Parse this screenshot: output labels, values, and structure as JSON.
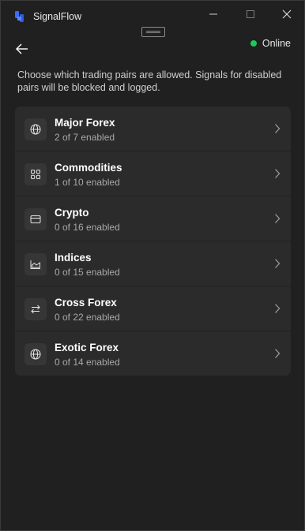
{
  "app": {
    "title": "SignalFlow"
  },
  "window_controls": {
    "minimize_icon": "minimize-icon",
    "maximize_icon": "maximize-icon",
    "close_icon": "close-icon"
  },
  "header": {
    "status_label": "Online",
    "status_color": "#22c55e"
  },
  "description": "Choose which trading pairs are allowed. Signals for disabled pairs will be blocked and logged.",
  "groups": [
    {
      "title": "Major Forex",
      "subtitle": "2 of 7 enabled",
      "icon": "globe-icon"
    },
    {
      "title": "Commodities",
      "subtitle": "1 of 10 enabled",
      "icon": "grid-icon"
    },
    {
      "title": "Crypto",
      "subtitle": "0 of 16 enabled",
      "icon": "card-icon"
    },
    {
      "title": "Indices",
      "subtitle": "0 of 15 enabled",
      "icon": "area-chart-icon"
    },
    {
      "title": "Cross Forex",
      "subtitle": "0 of 22 enabled",
      "icon": "swap-arrows-icon"
    },
    {
      "title": "Exotic Forex",
      "subtitle": "0 of 14 enabled",
      "icon": "globe-icon"
    }
  ]
}
